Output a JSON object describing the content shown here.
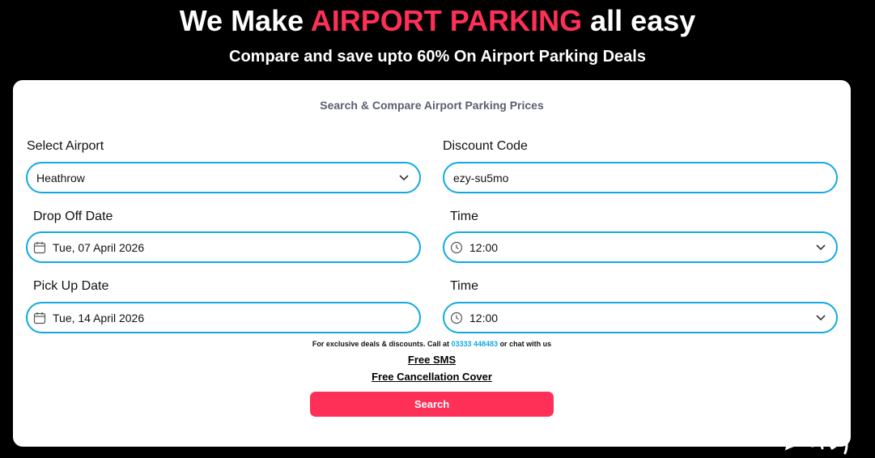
{
  "hero": {
    "title_prefix": "We Make",
    "title_accent": "AIRPORT PARKING",
    "title_suffix": "all easy",
    "subtitle": "Compare and save upto 60% On Airport Parking Deals"
  },
  "form": {
    "heading": "Search & Compare Airport Parking Prices",
    "airport": {
      "label": "Select Airport",
      "value": "Heathrow",
      "icon": "chevron-down-icon"
    },
    "discount": {
      "label": "Discount Code",
      "value": "ezy-su5mo"
    },
    "dropoff_date": {
      "label": "Drop Off Date",
      "value": "Tue, 07 April 2026",
      "icon": "calendar-icon"
    },
    "dropoff_time": {
      "label": "Time",
      "value": "12:00",
      "icon": "clock-icon"
    },
    "pickup_date": {
      "label": "Pick Up Date",
      "value": "Tue, 14 April 2026",
      "icon": "calendar-icon"
    },
    "pickup_time": {
      "label": "Time",
      "value": "12:00",
      "icon": "clock-icon"
    },
    "note_prefix": "For exclusive deals & discounts. Call at",
    "note_phone": "03333 448483",
    "note_suffix": "or chat with us",
    "free_sms": "Free SMS",
    "free_cancellation": "Free Cancellation Cover",
    "search_label": "Search"
  },
  "colors": {
    "accent": "#ff3057",
    "field_border": "#13a9e0",
    "background": "#000000"
  }
}
